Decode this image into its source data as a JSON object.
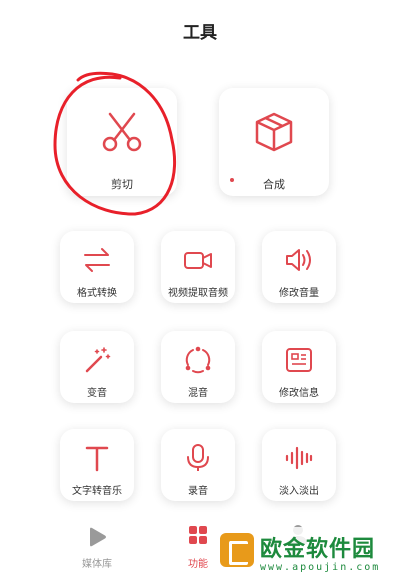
{
  "header": {
    "title": "工具"
  },
  "tools": {
    "cut": "剪切",
    "merge": "合成",
    "format_convert": "格式转换",
    "extract_audio": "视频提取音频",
    "volume": "修改音量",
    "voice_change": "变音",
    "mix": "混音",
    "edit_info": "修改信息",
    "text_to_music": "文字转音乐",
    "record": "录音",
    "fade": "淡入淡出"
  },
  "tabs": {
    "library": "媒体库",
    "functions": "功能"
  },
  "watermark": {
    "brand": "欧金软件园",
    "url": "www.apoujin.com"
  },
  "colors": {
    "accent": "#e0484f",
    "annotation": "#e8202a"
  }
}
